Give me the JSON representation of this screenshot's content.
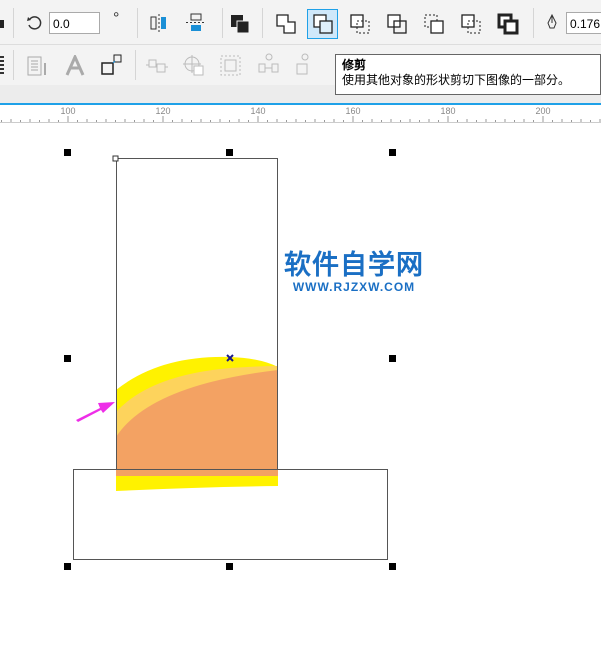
{
  "toolbar": {
    "rotation_value": "0.0",
    "degree_symbol": "°",
    "outline_width": "0.176"
  },
  "tooltip": {
    "title": "修剪",
    "description": "使用其他对象的形状剪切下图像的一部分。"
  },
  "ruler": {
    "labels": [
      "100",
      "120",
      "140",
      "160",
      "180",
      "200"
    ]
  },
  "watermark": {
    "title": "软件自学网",
    "url": "WWW.RJZXW.COM"
  },
  "colors": {
    "accent": "#1fa1e8",
    "yellow": "#fff200",
    "light_orange": "#fdd35c",
    "orange": "#f3a263",
    "arrow": "#ee2ee8",
    "watermark": "#1a6fc4"
  }
}
